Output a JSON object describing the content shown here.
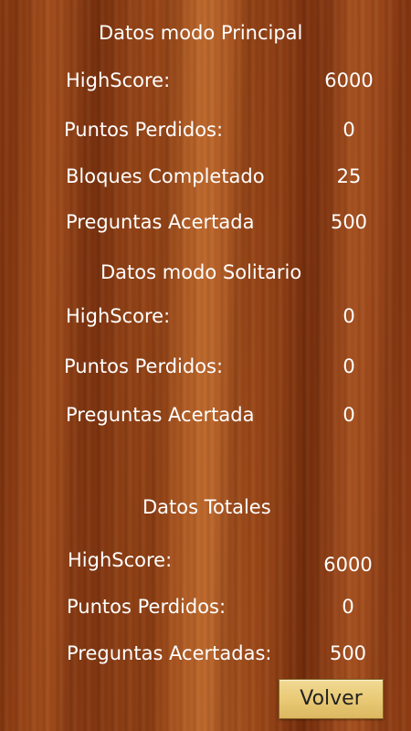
{
  "sections": {
    "principal": {
      "title": "Datos modo Principal",
      "rows": [
        {
          "label": "HighScore:",
          "value": "6000"
        },
        {
          "label": "Puntos Perdidos:",
          "value": "0"
        },
        {
          "label": "Bloques Completado",
          "value": "25"
        },
        {
          "label": "Preguntas Acertada",
          "value": "500"
        }
      ]
    },
    "solitario": {
      "title": "Datos modo Solitario",
      "rows": [
        {
          "label": "HighScore:",
          "value": "0"
        },
        {
          "label": "Puntos Perdidos:",
          "value": "0"
        },
        {
          "label": "Preguntas Acertada",
          "value": "0"
        }
      ]
    },
    "totales": {
      "title": "Datos Totales",
      "rows": [
        {
          "label": "HighScore:",
          "value": "6000"
        },
        {
          "label": "Puntos Perdidos:",
          "value": "0"
        },
        {
          "label": "Preguntas Acertadas:",
          "value": "500"
        }
      ]
    }
  },
  "back_button": {
    "label": "Volver"
  }
}
